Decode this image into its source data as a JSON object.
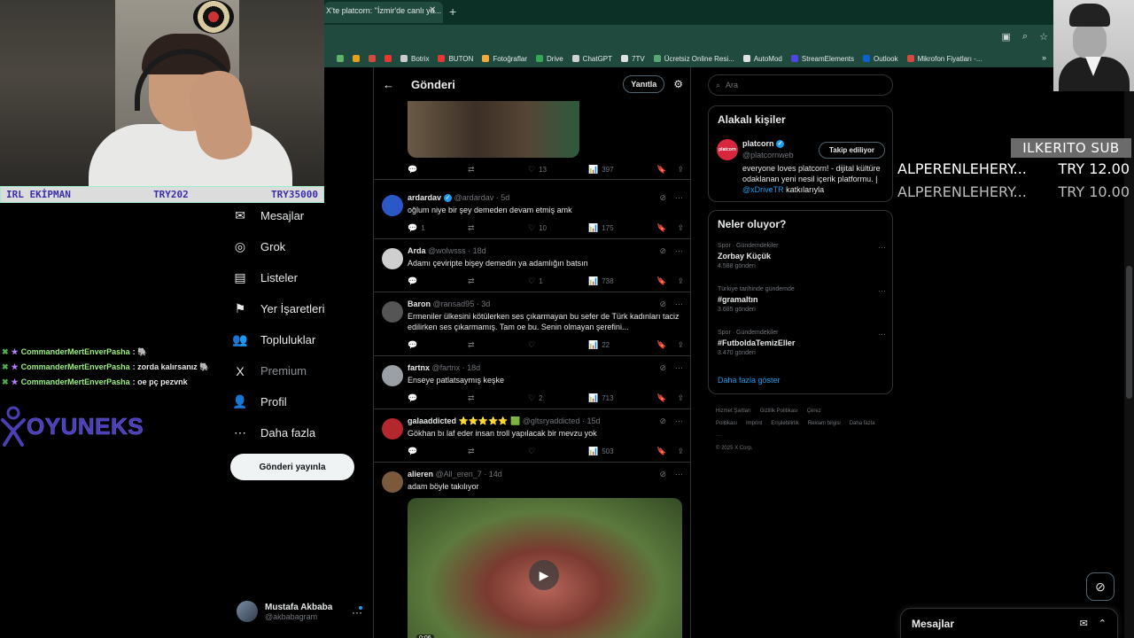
{
  "browser": {
    "tab_title": "X'te platcorn: \"İzmir'de canlı ya...",
    "tab_close": "✕",
    "new_tab": "+",
    "bookmarks": [
      {
        "label": "",
        "color": "#5fb36b"
      },
      {
        "label": "",
        "color": "#e3a21a"
      },
      {
        "label": "",
        "color": "#d24b3e"
      },
      {
        "label": "",
        "color": "#e53935"
      },
      {
        "label": "Botrix",
        "color": "#cccccc"
      },
      {
        "label": "BUTON",
        "color": "#e53935"
      },
      {
        "label": "Fotoğraflar",
        "color": "#f2a93b"
      },
      {
        "label": "Drive",
        "color": "#34a853"
      },
      {
        "label": "ChatGPT",
        "color": "#d0d0d0"
      },
      {
        "label": "7TV",
        "color": "#e0e0e0"
      },
      {
        "label": "Ücretsiz Online Resi...",
        "color": "#57a773"
      },
      {
        "label": "AutoMod",
        "color": "#e0e0e0"
      },
      {
        "label": "StreamElements",
        "color": "#4f46e5"
      },
      {
        "label": "Outlook",
        "color": "#0a64c8"
      },
      {
        "label": "Mikrofon Fiyatları -...",
        "color": "#d24b3e"
      }
    ],
    "bookmarks_more": "»"
  },
  "stream": {
    "bar_left": "IRL EKİPMAN",
    "bar_mid": "TRY202",
    "bar_right": "TRY35000",
    "chat": [
      {
        "user": "CommanderMertEnverPasha",
        "msg": ": 🐘"
      },
      {
        "user": "CommanderMertEnverPasha",
        "msg": ": zorda kalırsanız 🐘"
      },
      {
        "user": "CommanderMertEnverPasha",
        "msg": ": oe pç pezvnk"
      }
    ],
    "logo_text": "OYUNEKS",
    "sub_header": "ILKERITO SUB",
    "subs": [
      {
        "name": "ALPERENLEHERY...",
        "amount": "TRY 12.00",
        "color": "#ffffff"
      },
      {
        "name": "ALPERENLEHERY...",
        "amount": "TRY 10.00",
        "color": "#bdbdbd"
      }
    ]
  },
  "nav": {
    "items": [
      {
        "label": "Mesajlar",
        "icon": "✉",
        "dim": false
      },
      {
        "label": "Grok",
        "icon": "◎",
        "dim": false
      },
      {
        "label": "Listeler",
        "icon": "▤",
        "dim": false
      },
      {
        "label": "Yer İşaretleri",
        "icon": "⚑",
        "dim": false
      },
      {
        "label": "Topluluklar",
        "icon": "👥",
        "dim": false
      },
      {
        "label": "Premium",
        "icon": "X",
        "dim": true
      },
      {
        "label": "Profil",
        "icon": "👤",
        "dim": false
      },
      {
        "label": "Daha fazla",
        "icon": "⋯",
        "dim": false
      }
    ],
    "post_button": "Gönderi yayınla",
    "account_name": "Mustafa Akbaba",
    "account_handle": "@akbabagram",
    "account_more": "···"
  },
  "timeline": {
    "title": "Gönderi",
    "back": "←",
    "reply_button": "Yanıtla",
    "tune": "⚙",
    "top_post_stats": {
      "replies": "",
      "reposts": "",
      "likes": "13",
      "views": "397"
    },
    "tweets": [
      {
        "name": "ardardav",
        "verified": true,
        "handle": "@ardardav · 5d",
        "text": "oğlum niye bir şey demeden devam etmiş amk",
        "replies": "1",
        "reposts": "",
        "likes": "10",
        "views": "175",
        "avatar": "#2b58c8"
      },
      {
        "name": "Arda",
        "verified": false,
        "handle": "@wolwsss · 18d",
        "text": "Adamı çeviripte bişey demedin ya adamlığın batsın",
        "replies": "",
        "reposts": "",
        "likes": "1",
        "views": "738",
        "avatar": "#cfcfcf"
      },
      {
        "name": "Baron",
        "verified": false,
        "handle": "@ransad95 · 3d",
        "text": "Ermeniler ülkesini kötülerken ses çıkarmayan bu sefer de Türk kadınları taciz edilirken ses çıkarmamış. Tam oe bu. Senin olmayan şerefini...",
        "replies": "",
        "reposts": "",
        "likes": "",
        "views": "22",
        "avatar": "#555555"
      },
      {
        "name": "fartnx",
        "verified": false,
        "handle": "@fartnx · 18d",
        "text": "Enseye patlatsaymış keşke",
        "replies": "",
        "reposts": "",
        "likes": "2",
        "views": "713",
        "avatar": "#9aa0a6"
      },
      {
        "name": "galaaddicted ⭐⭐⭐⭐⭐ 🟩",
        "verified": false,
        "handle": "@gltsryaddicted · 15d",
        "text": "Gökhan bı laf eder insan troll yapılacak bir mevzu yok",
        "replies": "",
        "reposts": "",
        "likes": "",
        "views": "503",
        "avatar": "#b3282d"
      },
      {
        "name": "alieren",
        "verified": false,
        "handle": "@All_eren_7 · 14d",
        "text": "adam böyle takılıyor",
        "replies": "",
        "reposts": "",
        "likes": "",
        "views": "",
        "avatar": "#7b5a3c"
      }
    ],
    "video_time": "0:06"
  },
  "right": {
    "search_placeholder": "Ara",
    "who_title": "Alakalı kişiler",
    "who_name": "platcorn",
    "who_handle": "@platcornweb",
    "who_avatar_text": "platcorn",
    "follow_button": "Takip ediliyor",
    "who_bio": "everyone loves platcorn! - dijital kültüre odaklanan yeni nesil içerik platformu. |",
    "who_bio_link": "@xDriveTR",
    "who_bio_tail": "katkılarıyla",
    "trends_title": "Neler oluyor?",
    "trends": [
      {
        "category": "Spor · Gündemdekiler",
        "name": "Zorbay Küçük",
        "count": "4.588 gönderi"
      },
      {
        "category": "Türkiye tarihinde gündemde",
        "name": "#gramaltın",
        "count": "3.685 gönderi"
      },
      {
        "category": "Spor · Gündemdekiler",
        "name": "#FutboldaTemizEller",
        "count": "3.470 gönderi"
      }
    ],
    "show_more": "Daha fazla göster",
    "footer_links": [
      "Hizmet Şartları",
      "Gizlilik Politikası",
      "Çerez Politikası",
      "Imprint",
      "Erişilebilirlik",
      "Reklam bilgisi",
      "Daha fazla ···"
    ],
    "copyright": "© 2025 X Corp.",
    "messages_drawer": "Mesajlar"
  }
}
